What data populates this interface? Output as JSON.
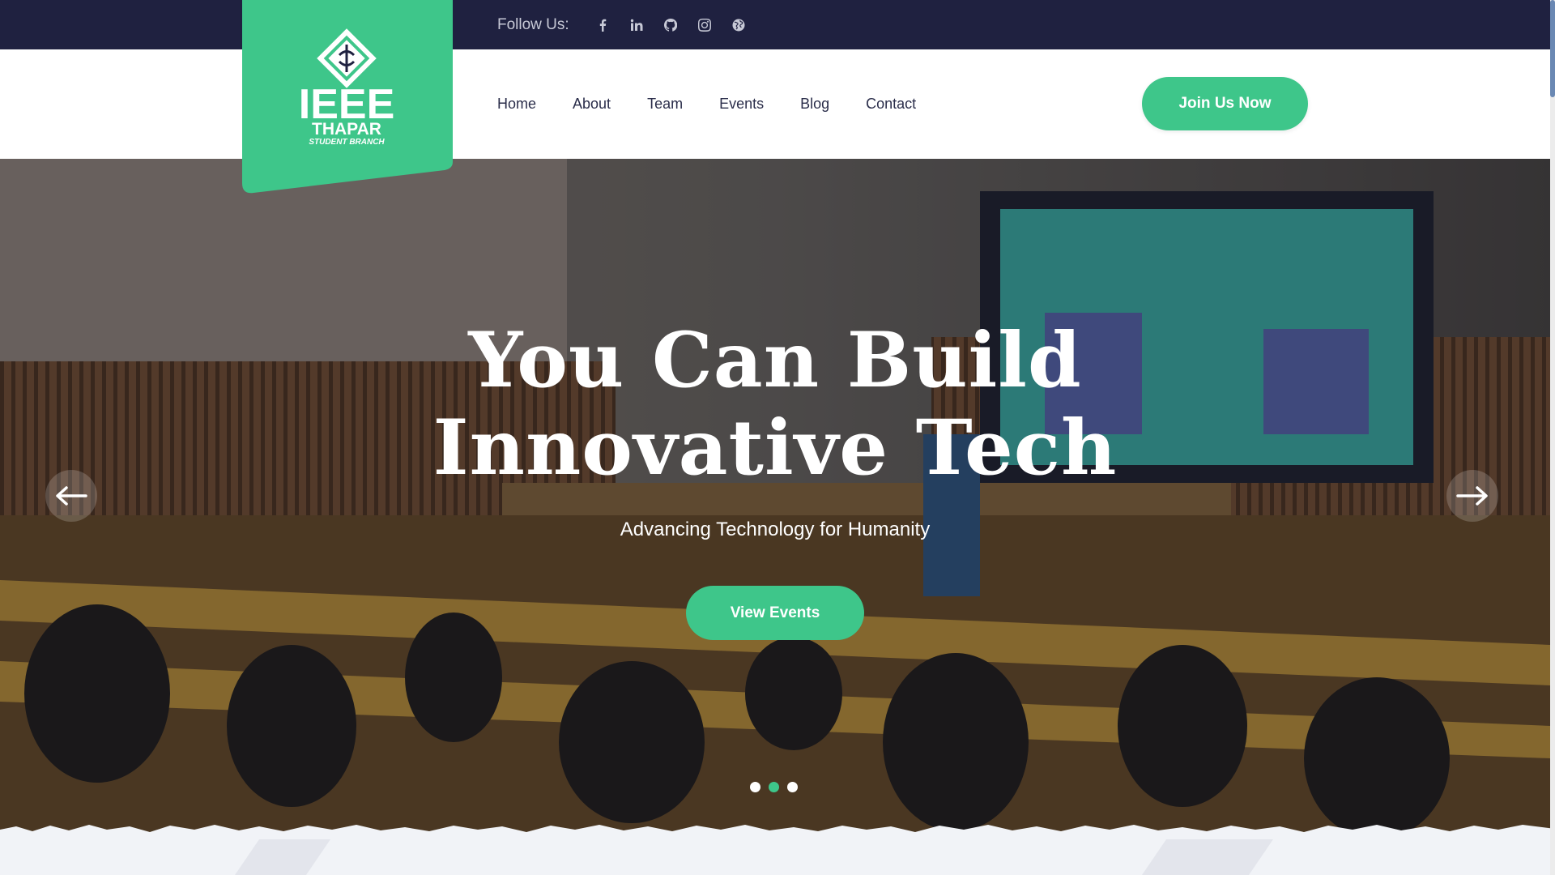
{
  "topbar": {
    "follow_label": "Follow Us:",
    "socials": [
      "facebook-icon",
      "linkedin-icon",
      "github-icon",
      "instagram-icon",
      "globe-icon"
    ]
  },
  "logo": {
    "line1": "IEEE",
    "line2": "THAPAR",
    "line3": "STUDENT BRANCH"
  },
  "nav": {
    "items": [
      "Home",
      "About",
      "Team",
      "Events",
      "Blog",
      "Contact"
    ],
    "cta": "Join Us Now"
  },
  "hero": {
    "title_line1": "You Can Build",
    "title_line2": "Innovative Tech",
    "subtitle": "Advancing Technology for Humanity",
    "button": "View Events",
    "slides": 3,
    "active_slide": 2
  },
  "colors": {
    "accent": "#3ec68a",
    "topbar": "#1f2140",
    "nav_text": "#2a2d4a"
  }
}
